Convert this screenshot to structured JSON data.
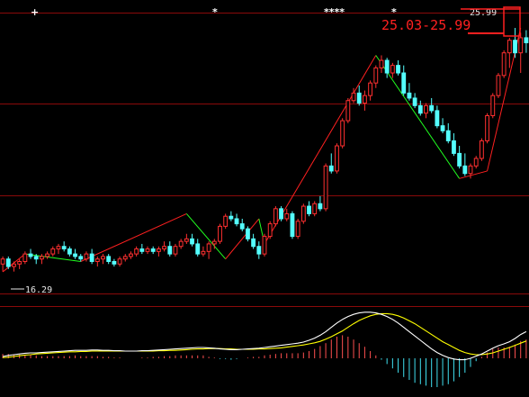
{
  "chart_data": [
    {
      "type": "candlestick",
      "title": "",
      "ylim": [
        15.5,
        26.6
      ],
      "colors": {
        "up": "#ff3030",
        "down": "#54ffff",
        "up_trend": "#ff2020",
        "down_trend": "#20ff20",
        "grid": "#8a0a0a"
      },
      "annotations": {
        "range_label": "25.03-25.99",
        "high_label": "25.99",
        "low_label": "16.29",
        "markers": [
          "+",
          "*",
          "****",
          "*"
        ]
      },
      "candles": [
        [
          16.6,
          16.9,
          16.3,
          16.8
        ],
        [
          16.8,
          16.9,
          16.4,
          16.5
        ],
        [
          16.5,
          16.7,
          16.3,
          16.6
        ],
        [
          16.6,
          16.8,
          16.4,
          16.7
        ],
        [
          16.7,
          17.1,
          16.6,
          17.0
        ],
        [
          17.0,
          17.2,
          16.8,
          16.9
        ],
        [
          16.9,
          17.0,
          16.6,
          16.8
        ],
        [
          16.8,
          17.0,
          16.6,
          16.9
        ],
        [
          16.9,
          17.1,
          16.8,
          17.0
        ],
        [
          17.0,
          17.3,
          16.9,
          17.2
        ],
        [
          17.2,
          17.4,
          17.0,
          17.3
        ],
        [
          17.3,
          17.5,
          17.1,
          17.2
        ],
        [
          17.2,
          17.3,
          16.9,
          17.0
        ],
        [
          17.0,
          17.2,
          16.8,
          16.9
        ],
        [
          16.9,
          17.0,
          16.7,
          16.8
        ],
        [
          16.8,
          17.1,
          16.7,
          17.0
        ],
        [
          17.0,
          17.2,
          16.6,
          16.7
        ],
        [
          16.7,
          16.9,
          16.5,
          16.8
        ],
        [
          16.8,
          17.0,
          16.6,
          16.9
        ],
        [
          16.9,
          17.0,
          16.6,
          16.7
        ],
        [
          16.7,
          16.8,
          16.5,
          16.6
        ],
        [
          16.6,
          16.9,
          16.5,
          16.8
        ],
        [
          16.8,
          17.0,
          16.7,
          16.9
        ],
        [
          16.9,
          17.1,
          16.8,
          17.0
        ],
        [
          17.0,
          17.3,
          16.9,
          17.2
        ],
        [
          17.2,
          17.4,
          17.0,
          17.1
        ],
        [
          17.1,
          17.3,
          17.0,
          17.2
        ],
        [
          17.2,
          17.3,
          17.0,
          17.1
        ],
        [
          17.1,
          17.3,
          16.9,
          17.2
        ],
        [
          17.2,
          17.5,
          17.1,
          17.3
        ],
        [
          17.3,
          17.5,
          16.9,
          17.0
        ],
        [
          17.0,
          17.4,
          16.9,
          17.3
        ],
        [
          17.3,
          17.6,
          17.2,
          17.5
        ],
        [
          17.5,
          17.8,
          17.4,
          17.6
        ],
        [
          17.6,
          17.8,
          17.3,
          17.4
        ],
        [
          17.4,
          17.6,
          16.9,
          17.0
        ],
        [
          17.0,
          17.3,
          16.9,
          17.1
        ],
        [
          17.1,
          17.5,
          16.8,
          17.4
        ],
        [
          17.4,
          17.6,
          17.2,
          17.5
        ],
        [
          17.5,
          18.2,
          17.4,
          18.1
        ],
        [
          18.1,
          18.6,
          18.0,
          18.5
        ],
        [
          18.5,
          18.7,
          18.3,
          18.4
        ],
        [
          18.4,
          18.6,
          18.1,
          18.2
        ],
        [
          18.2,
          18.4,
          17.9,
          18.0
        ],
        [
          18.0,
          18.1,
          17.5,
          17.6
        ],
        [
          17.6,
          17.8,
          17.2,
          17.3
        ],
        [
          17.3,
          17.5,
          16.8,
          17.0
        ],
        [
          17.0,
          17.8,
          16.9,
          17.7
        ],
        [
          17.7,
          18.3,
          17.6,
          18.2
        ],
        [
          18.2,
          18.9,
          18.1,
          18.8
        ],
        [
          18.8,
          18.9,
          18.3,
          18.4
        ],
        [
          18.4,
          18.8,
          18.3,
          18.6
        ],
        [
          18.6,
          18.7,
          17.6,
          17.7
        ],
        [
          17.7,
          18.4,
          17.6,
          18.3
        ],
        [
          18.3,
          19.0,
          18.2,
          18.9
        ],
        [
          18.9,
          19.1,
          18.5,
          18.6
        ],
        [
          18.6,
          19.1,
          18.5,
          19.0
        ],
        [
          19.0,
          19.3,
          18.7,
          18.8
        ],
        [
          18.8,
          20.6,
          18.7,
          20.5
        ],
        [
          20.5,
          21.0,
          20.2,
          20.3
        ],
        [
          20.3,
          21.4,
          20.2,
          21.3
        ],
        [
          21.3,
          22.4,
          21.2,
          22.3
        ],
        [
          22.3,
          23.2,
          22.2,
          23.1
        ],
        [
          23.1,
          23.6,
          23.0,
          23.4
        ],
        [
          23.4,
          23.7,
          22.9,
          23.0
        ],
        [
          23.0,
          23.5,
          22.7,
          23.3
        ],
        [
          23.3,
          23.9,
          23.1,
          23.8
        ],
        [
          23.8,
          24.5,
          23.6,
          24.4
        ],
        [
          24.4,
          24.9,
          24.2,
          24.7
        ],
        [
          24.7,
          24.8,
          24.0,
          24.2
        ],
        [
          24.2,
          24.6,
          24.0,
          24.5
        ],
        [
          24.5,
          24.7,
          24.1,
          24.2
        ],
        [
          24.2,
          24.5,
          23.3,
          23.4
        ],
        [
          23.4,
          23.8,
          23.1,
          23.2
        ],
        [
          23.2,
          23.4,
          22.8,
          22.9
        ],
        [
          22.9,
          23.1,
          22.5,
          22.6
        ],
        [
          22.6,
          23.0,
          22.4,
          22.9
        ],
        [
          22.9,
          23.2,
          22.6,
          22.7
        ],
        [
          22.7,
          22.9,
          22.0,
          22.1
        ],
        [
          22.1,
          22.4,
          21.8,
          21.9
        ],
        [
          21.9,
          22.2,
          21.4,
          21.5
        ],
        [
          21.5,
          21.8,
          20.9,
          21.0
        ],
        [
          21.0,
          21.3,
          20.4,
          20.5
        ],
        [
          20.5,
          21.0,
          20.1,
          20.2
        ],
        [
          20.2,
          20.6,
          20.0,
          20.5
        ],
        [
          20.5,
          20.9,
          20.4,
          20.8
        ],
        [
          20.8,
          21.6,
          20.7,
          21.5
        ],
        [
          21.5,
          22.6,
          21.4,
          22.5
        ],
        [
          22.5,
          23.4,
          22.4,
          23.3
        ],
        [
          23.3,
          24.2,
          23.2,
          24.1
        ],
        [
          24.1,
          25.1,
          24.0,
          25.0
        ],
        [
          25.0,
          25.6,
          24.4,
          25.5
        ],
        [
          25.5,
          25.99,
          24.8,
          25.0
        ],
        [
          25.0,
          25.8,
          24.2,
          25.6
        ],
        [
          25.6,
          25.9,
          25.0,
          25.4
        ]
      ],
      "zigzag": [
        {
          "i": 0,
          "price": 16.29
        },
        {
          "i": 4,
          "price": 17.0
        },
        {
          "i": 14,
          "price": 16.7
        },
        {
          "i": 33,
          "price": 18.6
        },
        {
          "i": 40,
          "price": 16.8
        },
        {
          "i": 46,
          "price": 18.4
        },
        {
          "i": 47,
          "price": 17.4
        },
        {
          "i": 67,
          "price": 24.9
        },
        {
          "i": 82,
          "price": 20.0
        },
        {
          "i": 87,
          "price": 20.3
        },
        {
          "i": 93,
          "price": 25.99
        }
      ]
    },
    {
      "type": "indicator",
      "ylim": [
        -1.0,
        1.4
      ],
      "colors": {
        "pos": "#ff5050",
        "neg": "#40e0f0",
        "line1": "#ffffff",
        "line2": "#ffff00"
      },
      "line1": [
        0.05,
        0.08,
        0.1,
        0.12,
        0.14,
        0.15,
        0.15,
        0.16,
        0.17,
        0.18,
        0.19,
        0.2,
        0.21,
        0.22,
        0.22,
        0.22,
        0.23,
        0.23,
        0.22,
        0.22,
        0.21,
        0.21,
        0.2,
        0.2,
        0.2,
        0.21,
        0.21,
        0.22,
        0.23,
        0.24,
        0.25,
        0.26,
        0.27,
        0.28,
        0.29,
        0.3,
        0.3,
        0.29,
        0.28,
        0.26,
        0.25,
        0.24,
        0.24,
        0.25,
        0.26,
        0.27,
        0.28,
        0.3,
        0.32,
        0.34,
        0.36,
        0.38,
        0.4,
        0.42,
        0.45,
        0.5,
        0.56,
        0.64,
        0.74,
        0.86,
        0.98,
        1.08,
        1.16,
        1.22,
        1.26,
        1.28,
        1.28,
        1.26,
        1.22,
        1.16,
        1.08,
        0.98,
        0.86,
        0.74,
        0.62,
        0.5,
        0.38,
        0.26,
        0.16,
        0.08,
        0.02,
        -0.02,
        -0.04,
        -0.04,
        0.0,
        0.06,
        0.12,
        0.2,
        0.28,
        0.35,
        0.4,
        0.46,
        0.55,
        0.66,
        0.74
      ],
      "line2": [
        0.02,
        0.03,
        0.05,
        0.07,
        0.09,
        0.1,
        0.12,
        0.13,
        0.14,
        0.15,
        0.16,
        0.17,
        0.18,
        0.18,
        0.19,
        0.19,
        0.2,
        0.2,
        0.2,
        0.2,
        0.2,
        0.2,
        0.2,
        0.2,
        0.2,
        0.2,
        0.2,
        0.2,
        0.21,
        0.21,
        0.22,
        0.22,
        0.23,
        0.24,
        0.25,
        0.26,
        0.26,
        0.27,
        0.27,
        0.27,
        0.26,
        0.26,
        0.25,
        0.25,
        0.25,
        0.25,
        0.26,
        0.26,
        0.27,
        0.28,
        0.29,
        0.31,
        0.33,
        0.35,
        0.37,
        0.4,
        0.43,
        0.47,
        0.53,
        0.6,
        0.68,
        0.76,
        0.86,
        0.96,
        1.05,
        1.12,
        1.18,
        1.22,
        1.24,
        1.24,
        1.22,
        1.18,
        1.12,
        1.04,
        0.96,
        0.86,
        0.76,
        0.66,
        0.56,
        0.46,
        0.38,
        0.3,
        0.22,
        0.16,
        0.12,
        0.1,
        0.1,
        0.12,
        0.15,
        0.2,
        0.25,
        0.3,
        0.36,
        0.42,
        0.48
      ],
      "bars": [
        0.12,
        0.12,
        0.11,
        0.1,
        0.1,
        0.1,
        0.08,
        0.06,
        0.06,
        0.06,
        0.06,
        0.06,
        0.06,
        0.08,
        0.06,
        0.06,
        0.06,
        0.06,
        0.04,
        0.04,
        0.02,
        0.02,
        0.0,
        0.0,
        0.0,
        0.02,
        0.02,
        0.04,
        0.04,
        0.06,
        0.06,
        0.08,
        0.08,
        0.08,
        0.08,
        0.08,
        0.08,
        0.04,
        0.02,
        -0.02,
        -0.02,
        -0.04,
        -0.02,
        0.0,
        0.02,
        0.04,
        0.04,
        0.08,
        0.1,
        0.12,
        0.14,
        0.14,
        0.14,
        0.14,
        0.16,
        0.2,
        0.26,
        0.34,
        0.42,
        0.52,
        0.6,
        0.64,
        0.6,
        0.52,
        0.42,
        0.32,
        0.2,
        0.08,
        -0.04,
        -0.16,
        -0.28,
        -0.4,
        -0.52,
        -0.6,
        -0.68,
        -0.72,
        -0.76,
        -0.8,
        -0.8,
        -0.76,
        -0.72,
        -0.64,
        -0.52,
        -0.4,
        -0.24,
        -0.08,
        0.04,
        0.16,
        0.26,
        0.3,
        0.3,
        0.32,
        0.38,
        0.48,
        0.52
      ]
    }
  ]
}
